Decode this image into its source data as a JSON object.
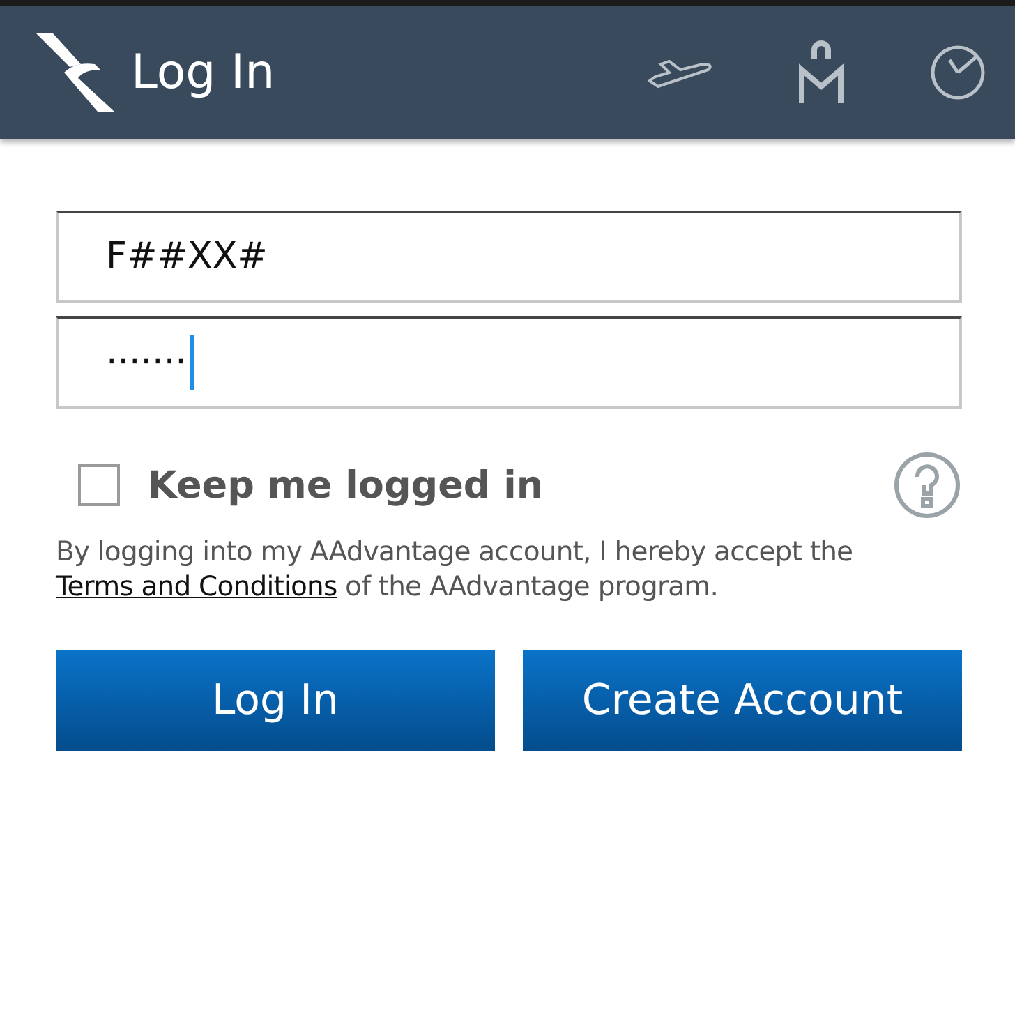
{
  "header": {
    "title": "Log In"
  },
  "username": {
    "value": "F##XX#"
  },
  "password": {
    "value": "·······",
    "focused": true
  },
  "keep_logged_in": {
    "label": "Keep me logged in",
    "checked": false
  },
  "terms": {
    "before": "By logging into my AAdvantage account, I hereby accept the",
    "link": "Terms and Conditions",
    "after": "of the AAdvantage program."
  },
  "buttons": [
    {
      "label": "Log In"
    },
    {
      "label": "Create Account"
    }
  ]
}
